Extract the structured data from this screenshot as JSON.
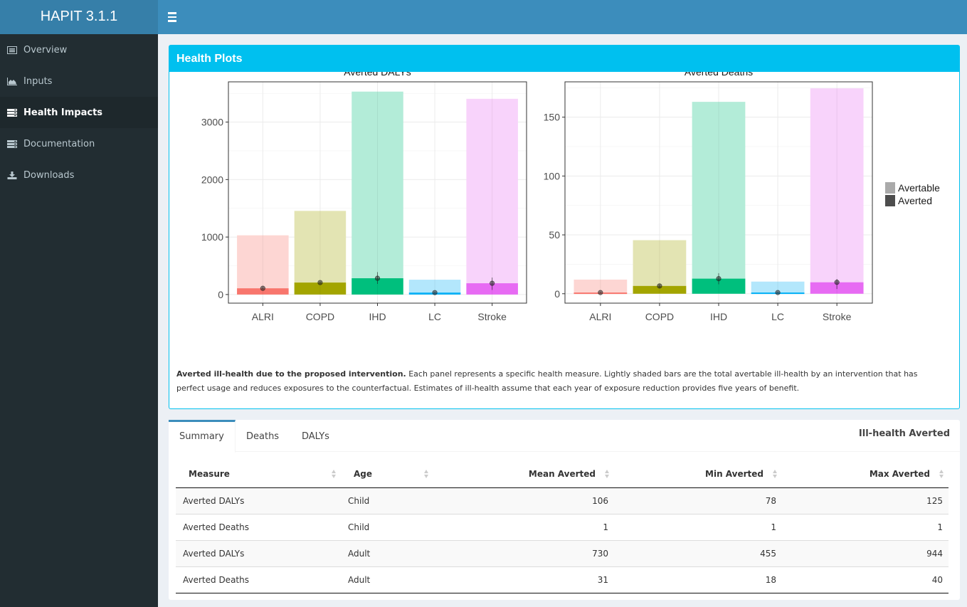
{
  "app": {
    "title": "HAPIT 3.1.1"
  },
  "sidebar": {
    "items": [
      {
        "label": "Overview",
        "icon": "list-alt-icon",
        "active": false
      },
      {
        "label": "Inputs",
        "icon": "area-chart-icon",
        "active": false
      },
      {
        "label": "Health Impacts",
        "icon": "tasks-icon",
        "active": true
      },
      {
        "label": "Documentation",
        "icon": "tasks-icon",
        "active": false
      },
      {
        "label": "Downloads",
        "icon": "download-icon",
        "active": false
      }
    ]
  },
  "box": {
    "title": "Health Plots",
    "caption_bold": "Averted ill-health due to the proposed intervention.",
    "caption_rest": " Each panel represents a specific health measure. Lightly shaded bars are the total avertable ill-health by an intervention that has perfect usage and reduces exposures to the counterfactual. Estimates of ill-health assume that each year of exposure reduction provides five years of benefit."
  },
  "colors": {
    "ALRI": "#F8766D",
    "COPD": "#A3A500",
    "IHD": "#00BF7D",
    "LC": "#00B0F6",
    "Stroke": "#E76BF3",
    "header": "#3c8dbc",
    "box_accent": "#00c0ef",
    "sidebar": "#222d32"
  },
  "chart_data": [
    {
      "type": "bar",
      "title": "Averted DALYs",
      "categories": [
        "ALRI",
        "COPD",
        "IHD",
        "LC",
        "Stroke"
      ],
      "series": [
        {
          "name": "Avertable",
          "values": [
            1030,
            1455,
            3530,
            258,
            3405
          ]
        },
        {
          "name": "Averted",
          "values": [
            108,
            208,
            283,
            33,
            196
          ]
        }
      ],
      "error_bars": {
        "point": [
          108,
          208,
          283,
          33,
          196
        ],
        "low": [
          90,
          190,
          185,
          20,
          80
        ],
        "high": [
          125,
          225,
          390,
          45,
          295
        ]
      },
      "yticks": [
        0,
        1000,
        2000,
        3000
      ],
      "ylim": [
        -150,
        3700
      ],
      "xlabel": "",
      "ylabel": "",
      "grid": true
    },
    {
      "type": "bar",
      "title": "Averted Deaths",
      "categories": [
        "ALRI",
        "COPD",
        "IHD",
        "LC",
        "Stroke"
      ],
      "series": [
        {
          "name": "Avertable",
          "values": [
            12,
            45.5,
            163,
            10.3,
            174.5
          ]
        },
        {
          "name": "Averted",
          "values": [
            1,
            6.6,
            12.8,
            1,
            9.7
          ]
        }
      ],
      "error_bars": {
        "point": [
          1,
          6.6,
          12.8,
          1,
          9.7
        ],
        "low": [
          0.5,
          5,
          8,
          0.5,
          4
        ],
        "high": [
          1.5,
          8,
          17.5,
          1.5,
          12.5
        ]
      },
      "yticks": [
        0,
        50,
        100,
        150
      ],
      "ylim": [
        -8,
        180
      ],
      "xlabel": "",
      "ylabel": "",
      "grid": true
    }
  ],
  "legend": {
    "items": [
      {
        "label": "Avertable",
        "color": "#aaaaaa"
      },
      {
        "label": "Averted",
        "color": "#4d4d4d"
      }
    ],
    "position": "right"
  },
  "tabs": {
    "items": [
      "Summary",
      "Deaths",
      "DALYs"
    ],
    "active": "Summary",
    "title": "Ill-health Averted"
  },
  "table": {
    "headers": [
      "Measure",
      "Age",
      "Mean Averted",
      "Min Averted",
      "Max Averted"
    ],
    "rows": [
      [
        "Averted DALYs",
        "Child",
        "106",
        "78",
        "125"
      ],
      [
        "Averted Deaths",
        "Child",
        "1",
        "1",
        "1"
      ],
      [
        "Averted DALYs",
        "Adult",
        "730",
        "455",
        "944"
      ],
      [
        "Averted Deaths",
        "Adult",
        "31",
        "18",
        "40"
      ]
    ]
  }
}
